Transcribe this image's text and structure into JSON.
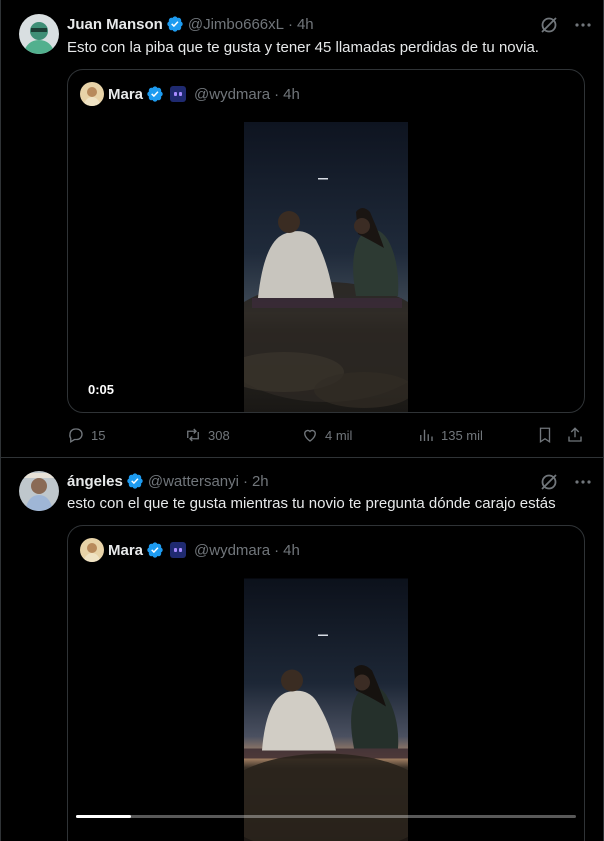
{
  "colors": {
    "background": "#000000",
    "text": "#e7e9ea",
    "muted": "#71767b",
    "verified": "#1d9bf0",
    "border": "#2f3336"
  },
  "tweets": [
    {
      "name": "Juan Manson",
      "handle": "@Jimbo666xL",
      "separator": "·",
      "time": "4h",
      "text": "Esto con la piba que te gusta y tener 45 llamadas perdidas de tu novia.",
      "quote": {
        "name": "Mara",
        "handle": "@wydmara",
        "separator": "·",
        "time": "4h",
        "video_duration": "0:05"
      },
      "actions": {
        "replies": "15",
        "reposts": "308",
        "likes": "4 mil",
        "views": "135 mil"
      }
    },
    {
      "name": "ángeles",
      "handle": "@wattersanyi",
      "separator": "·",
      "time": "2h",
      "text": "esto con el que te gusta mientras tu novio te pregunta dónde carajo estás",
      "quote": {
        "name": "Mara",
        "handle": "@wydmara",
        "separator": "·",
        "time": "4h",
        "video_progress": 0.11
      }
    }
  ],
  "icons": [
    "grok-icon",
    "more-icon",
    "verified-badge-icon",
    "reply-icon",
    "repost-icon",
    "like-icon",
    "views-icon",
    "bookmark-icon",
    "share-icon"
  ]
}
